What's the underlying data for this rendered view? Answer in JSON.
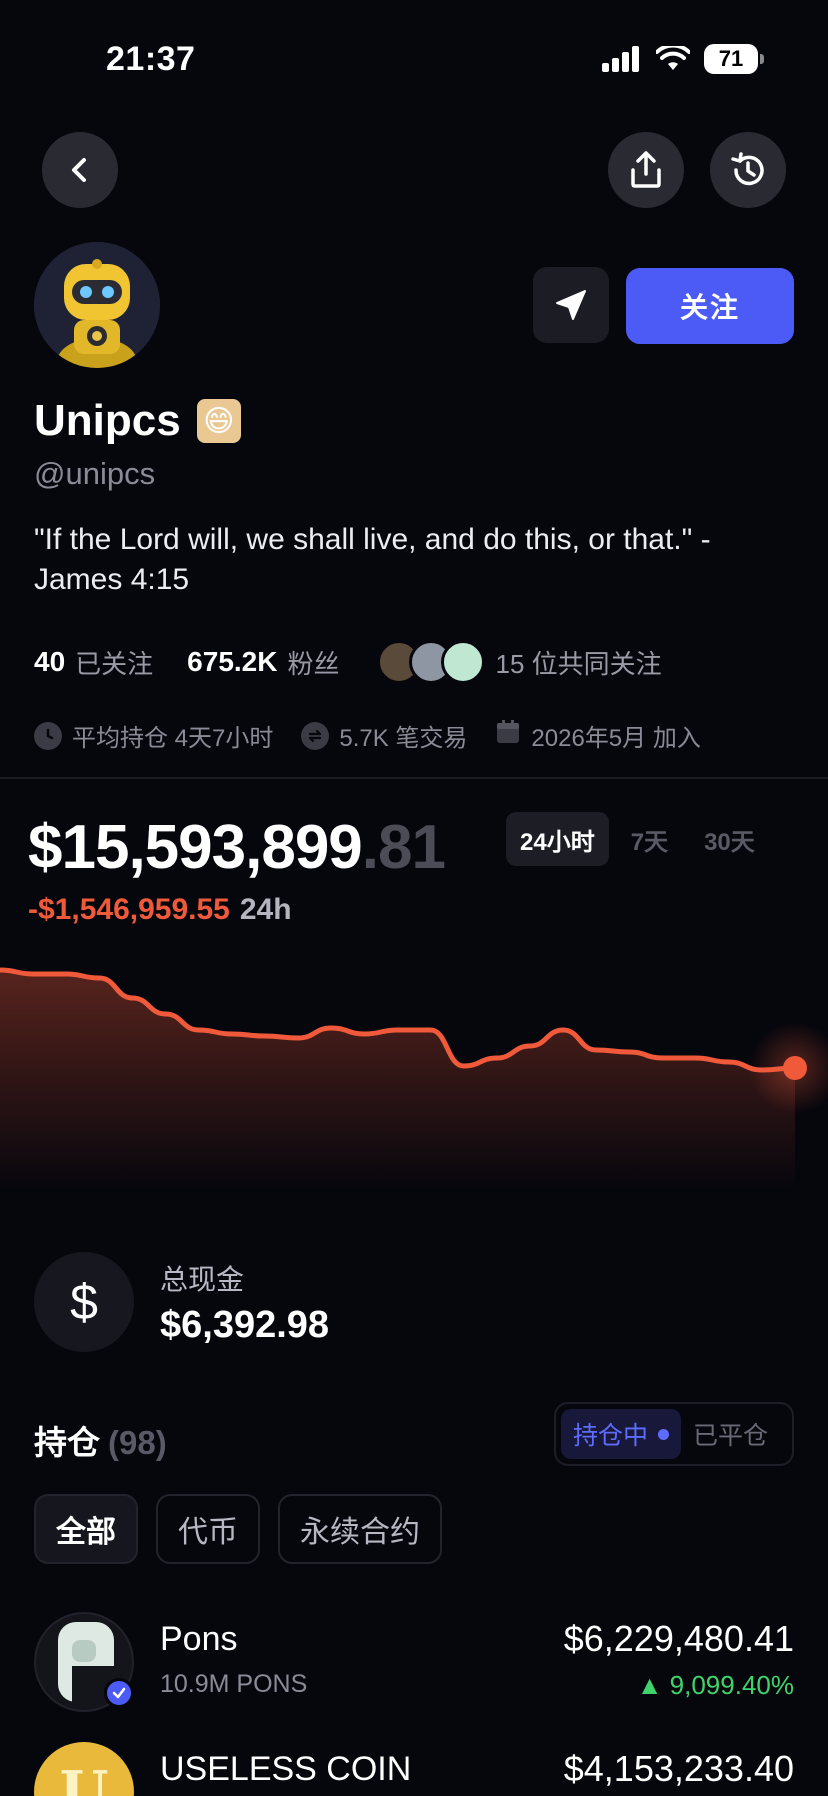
{
  "status_bar": {
    "time": "21:37",
    "battery": "71"
  },
  "profile": {
    "name": "Unipcs",
    "handle": "@unipcs",
    "bio": "\"If the Lord will, we shall live, and do this, or that.\" - James 4:15",
    "follow_label": "关注",
    "following_count": "40",
    "following_label": "已关注",
    "followers_count": "675.2K",
    "followers_label": "粉丝",
    "mutual_label": "15 位共同关注",
    "avg_hold": "平均持仓 4天7小时",
    "trades": "5.7K 笔交易",
    "joined": "2026年5月 加入"
  },
  "portfolio": {
    "balance_main": "$15,593,899",
    "balance_decimal": ".81",
    "change": "-$1,546,959.55",
    "change_period": "24h",
    "ranges": [
      "24小时",
      "7天",
      "30天"
    ],
    "active_range": "24小时",
    "accent_color": "#f05a3a"
  },
  "chart_data": {
    "type": "line",
    "title": "",
    "xlabel": "",
    "ylabel": "",
    "series": [
      {
        "values": [
          100,
          98,
          98,
          96,
          86,
          78,
          70,
          68,
          67,
          66,
          71,
          68,
          70,
          70,
          52,
          56,
          62,
          70,
          60,
          59,
          56,
          56,
          54,
          50,
          51
        ]
      }
    ]
  },
  "cash": {
    "symbol": "$",
    "label": "总现金",
    "value": "$6,392.98"
  },
  "holdings": {
    "title": "持仓",
    "count": "(98)",
    "toggle_open": "持仓中",
    "toggle_closed": "已平仓",
    "filters": [
      "全部",
      "代币",
      "永续合约"
    ],
    "items": [
      {
        "name": "Pons",
        "amount": "10.9M PONS",
        "value": "$6,229,480.41",
        "change": "▲ 9,099.40%"
      },
      {
        "name": "USELESS COIN",
        "value": "$4,153,233.40"
      }
    ]
  }
}
